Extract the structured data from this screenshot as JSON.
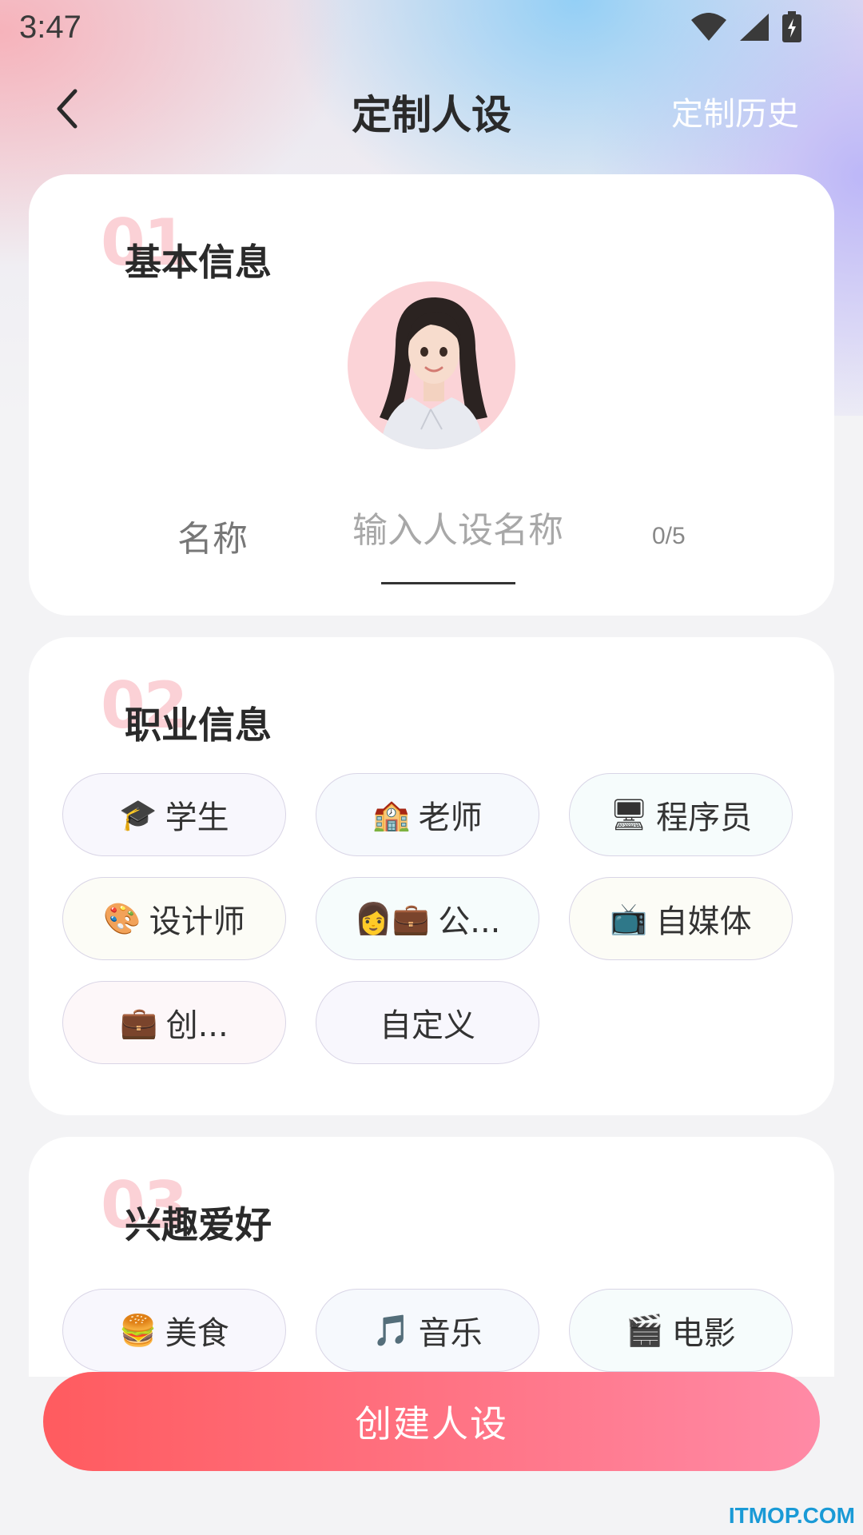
{
  "status_bar": {
    "time": "3:47"
  },
  "header": {
    "title": "定制人设",
    "history_label": "定制历史"
  },
  "basic_info": {
    "number": "01",
    "title": "基本信息",
    "name_label": "名称",
    "name_value": "",
    "name_placeholder": "输入人设名称",
    "name_count": "0/5"
  },
  "job_info": {
    "number": "02",
    "title": "职业信息",
    "options": [
      {
        "emoji": "🎓",
        "label": "学生",
        "icon": "graduation-cap-icon"
      },
      {
        "emoji": "🏫",
        "label": "老师",
        "icon": "school-icon"
      },
      {
        "emoji": "🖥",
        "label": "程序员",
        "icon": "computer-icon"
      },
      {
        "emoji": "🎨",
        "label": "设计师",
        "icon": "palette-icon"
      },
      {
        "emoji": "👩💼",
        "label": "公...",
        "icon": "office-worker-icon"
      },
      {
        "emoji": "📺",
        "label": "自媒体",
        "icon": "tv-icon"
      },
      {
        "emoji": "💼",
        "label": "创...",
        "icon": "briefcase-icon"
      },
      {
        "emoji": "",
        "label": "自定义",
        "icon": ""
      }
    ]
  },
  "hobby_info": {
    "number": "03",
    "title": "兴趣爱好",
    "options": [
      {
        "emoji": "🍔",
        "label": "美食",
        "icon": "burger-icon"
      },
      {
        "emoji": "🎵",
        "label": "音乐",
        "icon": "music-note-icon"
      },
      {
        "emoji": "🎬",
        "label": "电影",
        "icon": "clapperboard-icon"
      }
    ]
  },
  "create_button_label": "创建人设",
  "watermark": "ITMOP.COM",
  "colors": {
    "accent": "#ff5b5f",
    "section_number": "#fbd1d6",
    "avatar_bg": "#fbd3d7",
    "watermark": "#1a9ad6"
  }
}
